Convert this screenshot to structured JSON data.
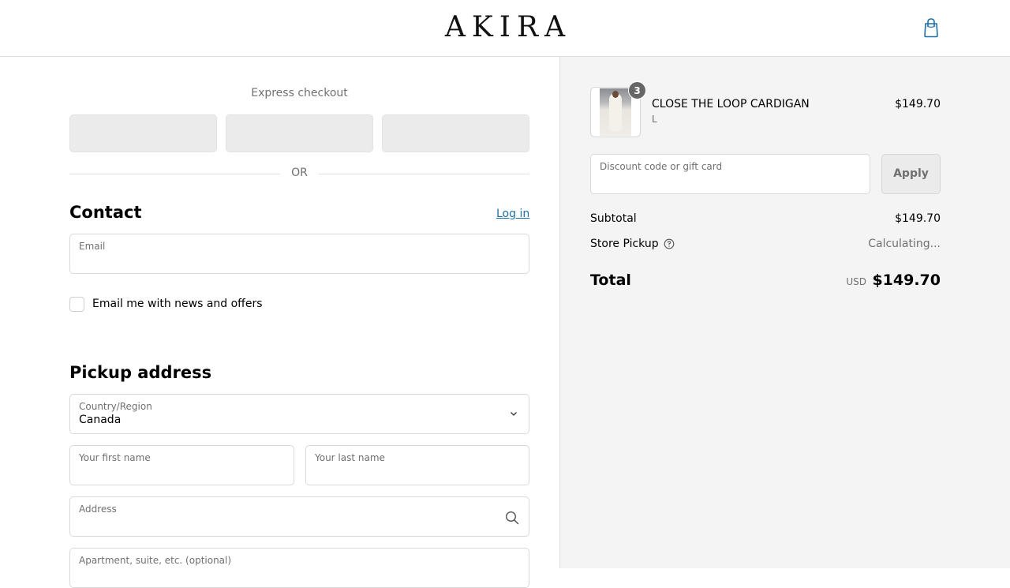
{
  "header": {
    "logo": "AKIRA",
    "cart_icon": "shopping-bag-icon",
    "accent": "#1f6fa8"
  },
  "express": {
    "title": "Express checkout",
    "or_label": "OR"
  },
  "contact": {
    "title": "Contact",
    "login_label": "Log in",
    "email_label": "Email",
    "email_value": "",
    "newsletter_label": "Email me with news and offers",
    "newsletter_checked": false
  },
  "pickup": {
    "title": "Pickup address",
    "country_label": "Country/Region",
    "country_value": "Canada",
    "first_name_placeholder": "Your first name",
    "last_name_placeholder": "Your last name",
    "address_placeholder": "Address",
    "apartment_placeholder": "Apartment, suite, etc. (optional)"
  },
  "summary": {
    "item": {
      "name": "CLOSE THE LOOP CARDIGAN",
      "variant": "L",
      "price": "$149.70",
      "quantity": "3"
    },
    "discount_placeholder": "Discount code or gift card",
    "apply_label": "Apply",
    "subtotal_label": "Subtotal",
    "subtotal_value": "$149.70",
    "shipping_label": "Store Pickup",
    "shipping_value": "Calculating...",
    "total_label": "Total",
    "total_currency": "USD",
    "total_value": "$149.70"
  }
}
